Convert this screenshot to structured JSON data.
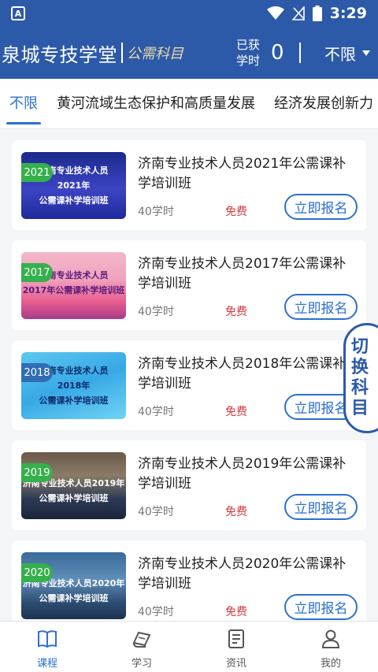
{
  "status_bar": {
    "time": "3:29",
    "app_icon": "A"
  },
  "header": {
    "brand_title": "泉城专技学堂",
    "brand_subtitle": "公需科目",
    "hours_label_line1": "已获",
    "hours_label_line2": "学时",
    "hours_value": "0",
    "filter_label": "不限"
  },
  "tabs": [
    {
      "label": "不限",
      "active": true
    },
    {
      "label": "黄河流域生态保护和高质量发展",
      "active": false
    },
    {
      "label": "经济发展创新力",
      "active": false
    }
  ],
  "courses": [
    {
      "year_badge": "2021",
      "thumb_line1": "济南专业技术人员",
      "thumb_line2": "2021年",
      "thumb_line3": "公需课补学培训班",
      "title": "济南专业技术人员2021年公需课补学培训班",
      "hours": "40学时",
      "price": "免费",
      "action": "立即报名"
    },
    {
      "year_badge": "2017",
      "thumb_line1": "济南专业技术人员",
      "thumb_line2": "2017年公需课补学培训班",
      "thumb_line3": "",
      "title": "济南专业技术人员2017年公需课补学培训班",
      "hours": "40学时",
      "price": "免费",
      "action": "立即报名"
    },
    {
      "year_badge": "2018",
      "thumb_line1": "济南专业技术人员",
      "thumb_line2": "2018年",
      "thumb_line3": "公需课补学培训班",
      "title": "济南专业技术人员2018年公需课补学培训班",
      "hours": "40学时",
      "price": "免费",
      "action": "立即报名"
    },
    {
      "year_badge": "2019",
      "thumb_line1": "济南专业技术人员2019年",
      "thumb_line2": "公需课补学培训班",
      "thumb_line3": "",
      "title": "济南专业技术人员2019年公需课补学培训班",
      "hours": "40学时",
      "price": "免费",
      "action": "立即报名"
    },
    {
      "year_badge": "2020",
      "thumb_line1": "济南专业技术人员2020年",
      "thumb_line2": "公需课补学培训班",
      "thumb_line3": "",
      "title": "济南专业技术人员2020年公需课补学培训班",
      "hours": "40学时",
      "price": "免费",
      "action": "立即报名"
    }
  ],
  "floating_switch": {
    "chars": [
      "切",
      "换",
      "科",
      "目"
    ]
  },
  "bottom_nav": [
    {
      "label": "课程",
      "icon": "book-open-icon",
      "active": true
    },
    {
      "label": "学习",
      "icon": "books-icon",
      "active": false
    },
    {
      "label": "资讯",
      "icon": "news-icon",
      "active": false
    },
    {
      "label": "我的",
      "icon": "user-icon",
      "active": false
    }
  ],
  "colors": {
    "primary": "#2c5aa8",
    "accent": "#2c6fd1",
    "price": "#d23b3b",
    "badge": "#35b04c"
  }
}
